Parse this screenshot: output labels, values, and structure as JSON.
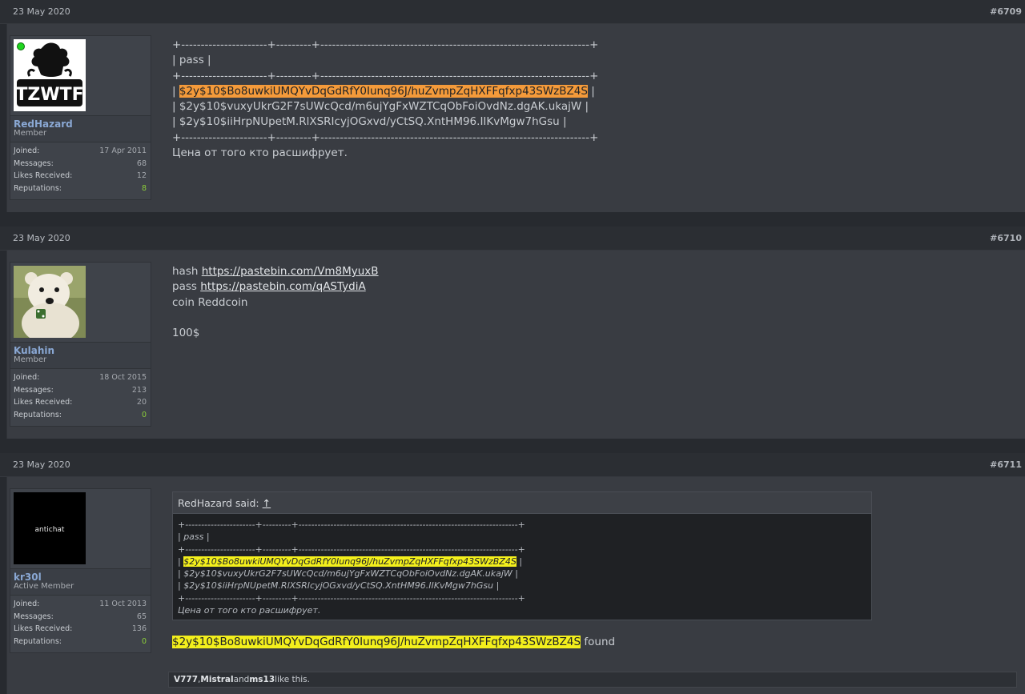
{
  "posts": [
    {
      "date": "23 May 2020",
      "number": "#6709",
      "user": {
        "name": "RedHazard",
        "title": "Member",
        "online": true,
        "avatar_text": "TZWTF",
        "stats": [
          {
            "label": "Joined:",
            "value": "17 Apr 2011"
          },
          {
            "label": "Messages:",
            "value": "68"
          },
          {
            "label": "Likes Received:",
            "value": "12"
          },
          {
            "label": "Reputations:",
            "value": "8"
          }
        ]
      },
      "lines": {
        "sep": "+----------------------+---------+---------------------------------------------------------------------+",
        "pass": "| pass |",
        "hash1": "$2y$10$Bo8uwkiUMQYvDqGdRfY0Iunq96J/huZvmpZqHXFFqfxp43SWzBZ4S",
        "hash2": "| $2y$10$vuxyUkrG2F7sUWcQcd/m6ujYgFxWZTCqObFoiOvdNz.dgAK.ukajW |",
        "hash3": "| $2y$10$iiHrpNUpetM.RlXSRIcyjOGxvd/yCtSQ.XntHM96.IIKvMgw7hGsu |",
        "note": "Цена от того кто расшифрует."
      }
    },
    {
      "date": "23 May 2020",
      "number": "#6710",
      "user": {
        "name": "Kulahin",
        "title": "Member",
        "stats": [
          {
            "label": "Joined:",
            "value": "18 Oct 2015"
          },
          {
            "label": "Messages:",
            "value": "213"
          },
          {
            "label": "Likes Received:",
            "value": "20"
          },
          {
            "label": "Reputations:",
            "value": "0"
          }
        ]
      },
      "lines": {
        "hash_label": "hash",
        "hash_link": "https://pastebin.com/Vm8MyuxB",
        "pass_label": "pass",
        "pass_link": "https://pastebin.com/qASTydiA",
        "coin": "coin Reddcoin",
        "price": "100$"
      }
    },
    {
      "date": "23 May 2020",
      "number": "#6711",
      "user": {
        "name": "kr30l",
        "title": "Active Member",
        "avatar_text": "antichat",
        "stats": [
          {
            "label": "Joined:",
            "value": "11 Oct 2013"
          },
          {
            "label": "Messages:",
            "value": "65"
          },
          {
            "label": "Likes Received:",
            "value": "136"
          },
          {
            "label": "Reputations:",
            "value": "0"
          }
        ]
      },
      "quote": {
        "author": "RedHazard said:",
        "arrow": "↑",
        "sep": "+----------------------+---------+---------------------------------------------------------------------+",
        "pass": "| pass |",
        "hash1": "$2y$10$Bo8uwkiUMQYvDqGdRfY0Iunq96J/huZvmpZqHXFFqfxp43SWzBZ4S",
        "hash2": "| $2y$10$vuxyUkrG2F7sUWcQcd/m6ujYgFxWZTCqObFoiOvdNz.dgAK.ukajW |",
        "hash3": "| $2y$10$iiHrpNUpetM.RlXSRIcyjOGxvd/yCtSQ.XntHM96.IIKvMgw7hGsu |",
        "note": "Цена от того кто расшифрует."
      },
      "reply": {
        "hash": "$2y$10$Bo8uwkiUMQYvDqGdRfY0Iunq96J/huZvmpZqHXFFqfxp43SWzBZ4S",
        "found": "found"
      },
      "likes": {
        "user1": "V777",
        "sep1": ", ",
        "user2": "Mistral",
        "and": " and ",
        "user3": "ms13",
        "suffix": " like this."
      }
    }
  ],
  "colors": {
    "background": "#272a2f",
    "post_body": "#393c42",
    "username": "#8aa8d4",
    "highlight_orange": "#f49a3a",
    "highlight_yellow": "#f3ef1c",
    "reputation_positive": "#8ccf3a"
  }
}
